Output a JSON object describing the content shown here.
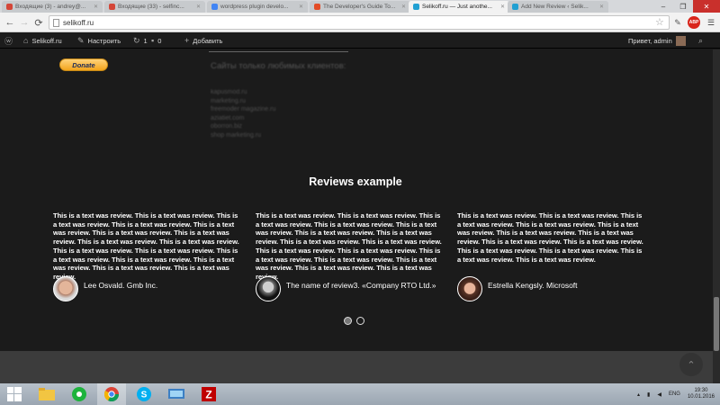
{
  "browser": {
    "tabs": [
      {
        "label": "Входящие (3) - andrey@...",
        "color": "#d44638",
        "active": false
      },
      {
        "label": "Входящие (33) - selfinc...",
        "color": "#d44638",
        "active": false
      },
      {
        "label": "wordpress plugin develo...",
        "color": "#4285f4",
        "active": false
      },
      {
        "label": "The Developer's Guide To...",
        "color": "#e34c26",
        "active": false
      },
      {
        "label": "Selikoff.ru — Just anothe...",
        "color": "#21a0d2",
        "active": true
      },
      {
        "label": "Add New Review ‹ Selik...",
        "color": "#21a0d2",
        "active": false
      }
    ],
    "url": "selikoff.ru",
    "abp_label": "ABP"
  },
  "adminbar": {
    "site": "Selikoff.ru",
    "customize": "Настроить",
    "updates": "1",
    "comments": "0",
    "add_new": "Добавить",
    "greeting": "Привет, admin"
  },
  "sidebar": {
    "donate_label": "Donate",
    "blurred_title": "Сайты только любимых клиентов:",
    "blurred_links": [
      "kapusmod.ru",
      "marketing.ru",
      "freemoder magazine.ru",
      "aziatiet.com",
      "oborron.biz",
      "shop marketing.ru"
    ]
  },
  "reviews": {
    "title": "Reviews example",
    "items": [
      {
        "text": "This is a text was review. This is a text was review. This is a text was review. This is a text was review. This is a text was review. This is a text was review. This is a text was review. This is a text was review. This is a text was review. This is a text was review. This is a text was review. This is a text was review. This is a text was review. This is a text was review. This is a text was review. This is a text was review.",
        "author": "Lee Osvald. Gmb Inc."
      },
      {
        "text": "This is a text was review. This is a text was review. This is a text was review. This is a text was review. This is a text was review. This is a text was review. This is a text was review. This is a text was review. This is a text was review. This is a text was review. This is a text was review. This is a text was review. This is a text was review. This is a text was review. This is a text was review. This is a text was review.",
        "author": "The name of review3. «Company RTO Ltd.»"
      },
      {
        "text": "This is a text was review. This is a text was review. This is a text was review. This is a text was review. This is a text was review. This is a text was review. This is a text was review. This is a text was review. This is a text was review. This is a text was review. This is a text was review. This is a text was review. This is a text was review.",
        "author": "Estrella Kengsly. Microsoft"
      }
    ],
    "active_slide": 1,
    "slide_count": 2
  },
  "taskbar": {
    "lang": "ENG",
    "time": "19:30",
    "date": "10.01.2016"
  }
}
